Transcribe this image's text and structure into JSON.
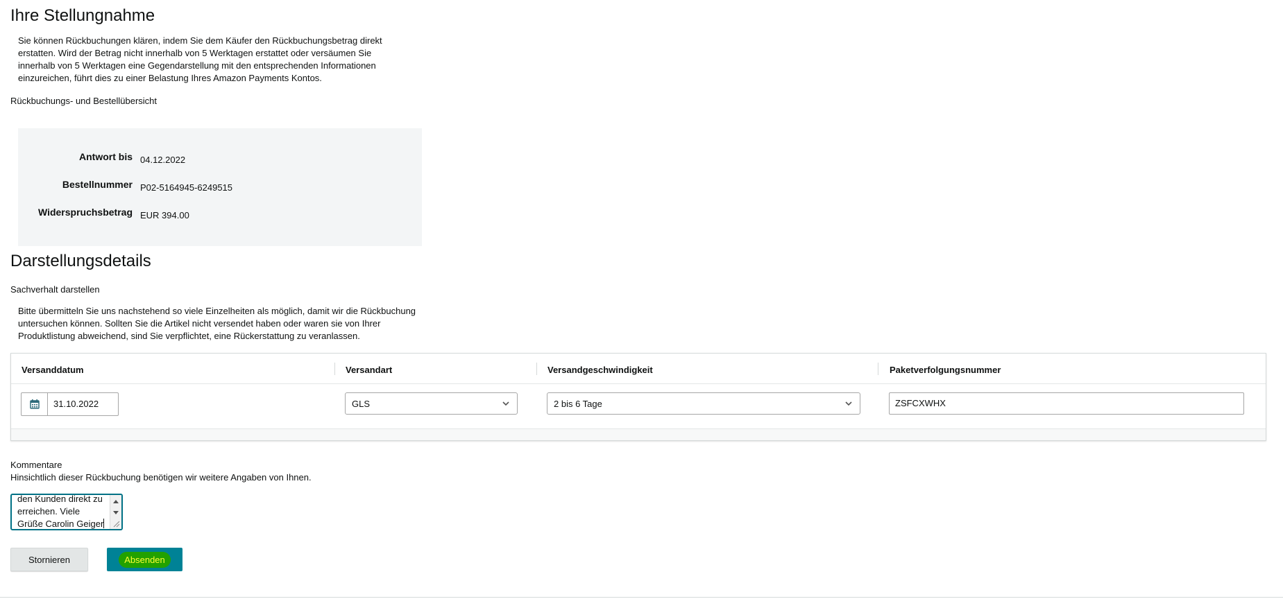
{
  "response_section": {
    "title": "Ihre Stellungnahme",
    "intro": "Sie können Rückbuchungen klären, indem Sie dem Käufer den Rückbuchungsbetrag direkt erstatten. Wird der Betrag nicht innerhalb von 5 Werktagen erstattet oder versäumen Sie innerhalb von 5 Werktagen eine Gegendarstellung mit den entsprechenden Informationen einzureichen, führt dies zu einer Belastung Ihres Amazon Payments Kontos.",
    "overview_label": "Rückbuchungs- und Bestellübersicht"
  },
  "summary": {
    "rows": [
      {
        "label": "Antwort bis",
        "value": "04.12.2022"
      },
      {
        "label": "Bestellnummer",
        "value": "P02-5164945-6249515"
      },
      {
        "label": "Widerspruchsbetrag",
        "value": "EUR 394.00"
      }
    ]
  },
  "details_section": {
    "title": "Darstellungsdetails",
    "sublabel": "Sachverhalt darstellen",
    "intro": "Bitte übermitteln Sie uns nachstehend so viele Einzelheiten als möglich, damit wir die Rückbuchung untersuchen können. Sollten Sie die Artikel nicht versendet haben oder waren sie von Ihrer Produktlistung abweichend, sind Sie verpflichtet, eine Rückerstattung zu veranlassen."
  },
  "shipping_table": {
    "headers": [
      "Versanddatum",
      "Versandart",
      "Versandgeschwindigkeit",
      "Paketverfolgungsnummer"
    ],
    "ship_date": "31.10.2022",
    "carrier": "GLS",
    "speed": "2 bis 6 Tage",
    "tracking_number": "ZSFCXWHX"
  },
  "comments": {
    "label": "Kommentare",
    "hint": "Hinsichtlich dieser Rückbuchung benötigen wir weitere Angaben von Ihnen.",
    "text": "den Kunden direkt zu\nerreichen. Viele\nGrüße Carolin Geiger"
  },
  "actions": {
    "cancel_label": "Stornieren",
    "submit_label": "Absenden"
  },
  "colors": {
    "primary_button": "#008296",
    "highlight_bg": "#22a100",
    "highlight_text": "#ffff33",
    "focus_border": "#007185"
  },
  "icons": {
    "calendar": "calendar-icon",
    "dropdown": "chevron-down-icon"
  }
}
